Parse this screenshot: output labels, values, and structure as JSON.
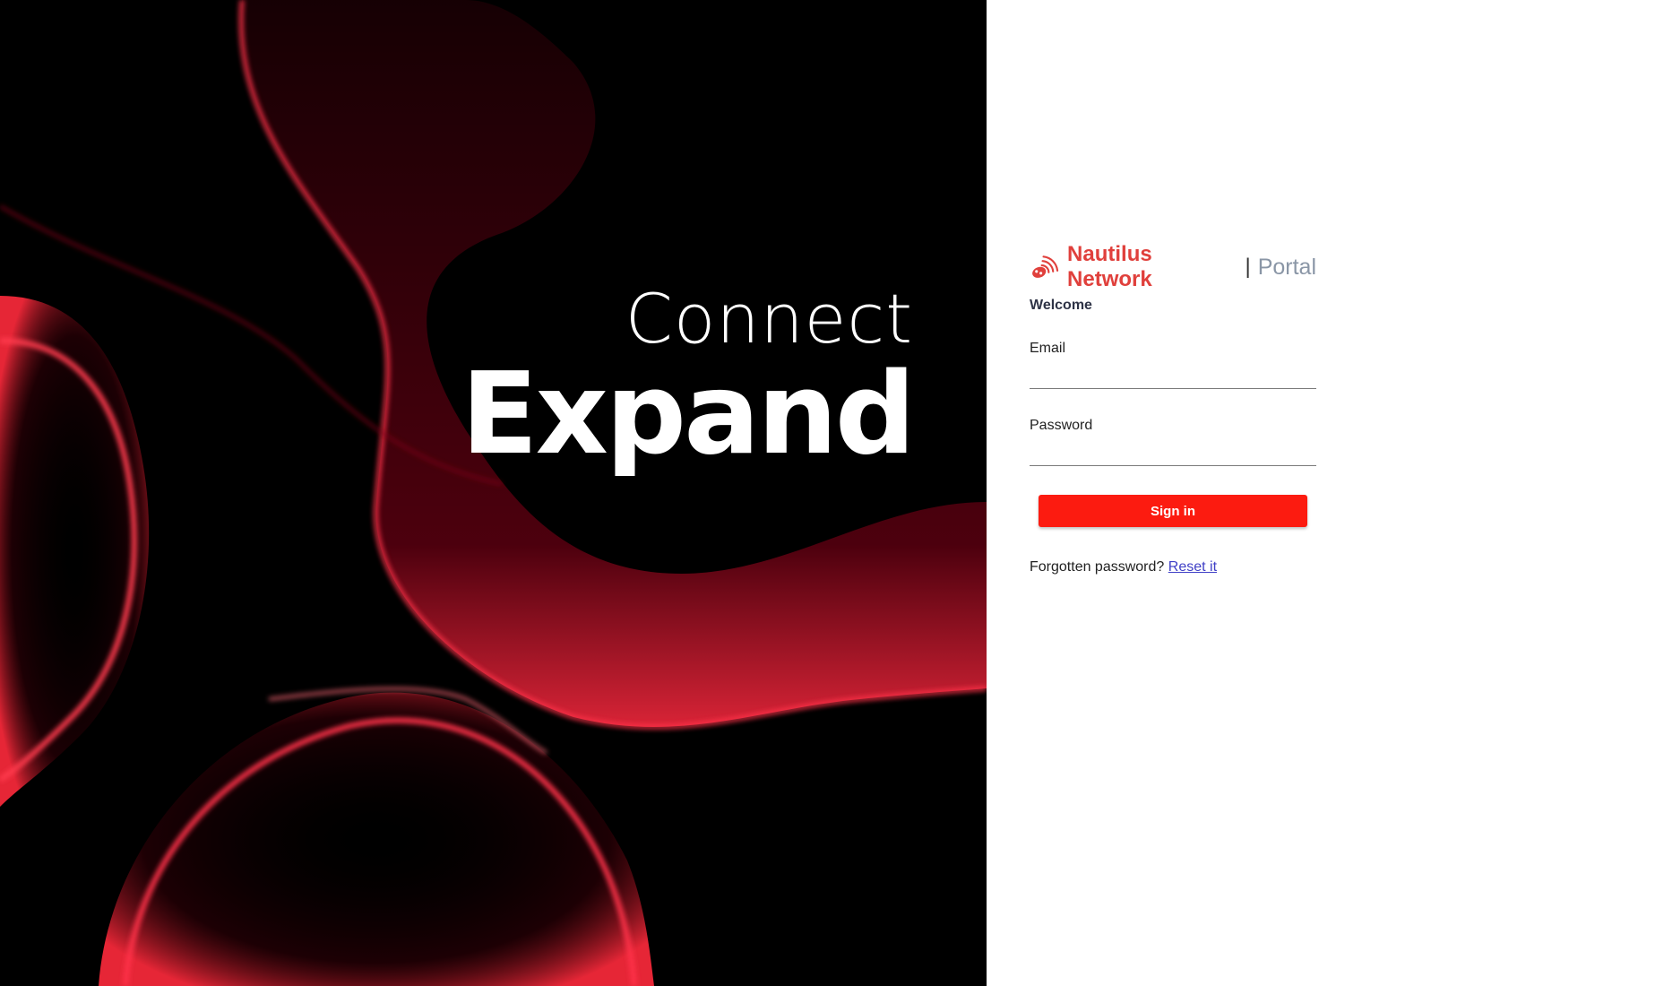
{
  "hero": {
    "line1": "Connect",
    "line2": "Expand",
    "background_color": "#000000",
    "accent_color": "#ff2a3c"
  },
  "brand": {
    "icon": "satellite-signal-icon",
    "name": "Nautilus Network",
    "separator": "|",
    "suffix": "Portal",
    "name_color": "#e0403c"
  },
  "form": {
    "welcome": "Welcome",
    "email_label": "Email",
    "email_value": "",
    "password_label": "Password",
    "password_value": "",
    "signin_label": "Sign in",
    "signin_color": "#fc1b10",
    "forgot_text": "Forgotten password?",
    "reset_link": "Reset it"
  }
}
